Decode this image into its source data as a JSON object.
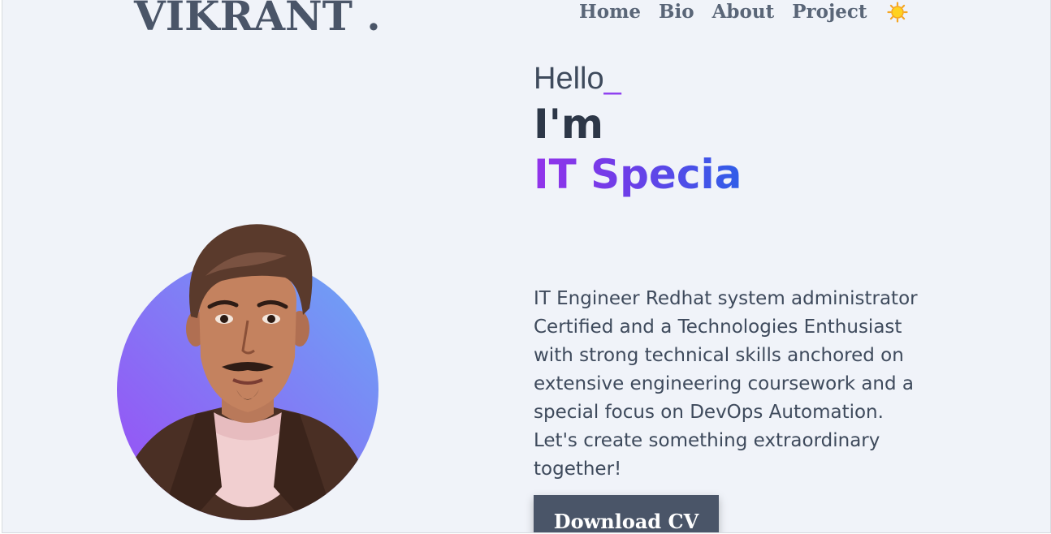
{
  "brand": {
    "logo_text": "VIKRANT ."
  },
  "nav": {
    "items": [
      {
        "label": "Home"
      },
      {
        "label": "Bio"
      },
      {
        "label": "About"
      },
      {
        "label": "Project"
      }
    ],
    "theme_icon": "sun-icon"
  },
  "hero": {
    "greeting": "Hello",
    "cursor": "_",
    "intro": "I'm",
    "role_typed": "IT Specia",
    "bio": "IT Engineer Redhat system administrator Certified and a Technologies Enthusiast with strong technical skills anchored on extensive engineering coursework and a special focus on DevOps Automation. Let's create something extraordinary together!",
    "cta_label": "Download CV"
  },
  "colors": {
    "background": "#f0f3f9",
    "text": "#3e4a5c",
    "heading": "#2d3748",
    "accent_purple": "#9333ea",
    "accent_blue": "#2f5ee8",
    "button_bg": "#4a5568"
  }
}
